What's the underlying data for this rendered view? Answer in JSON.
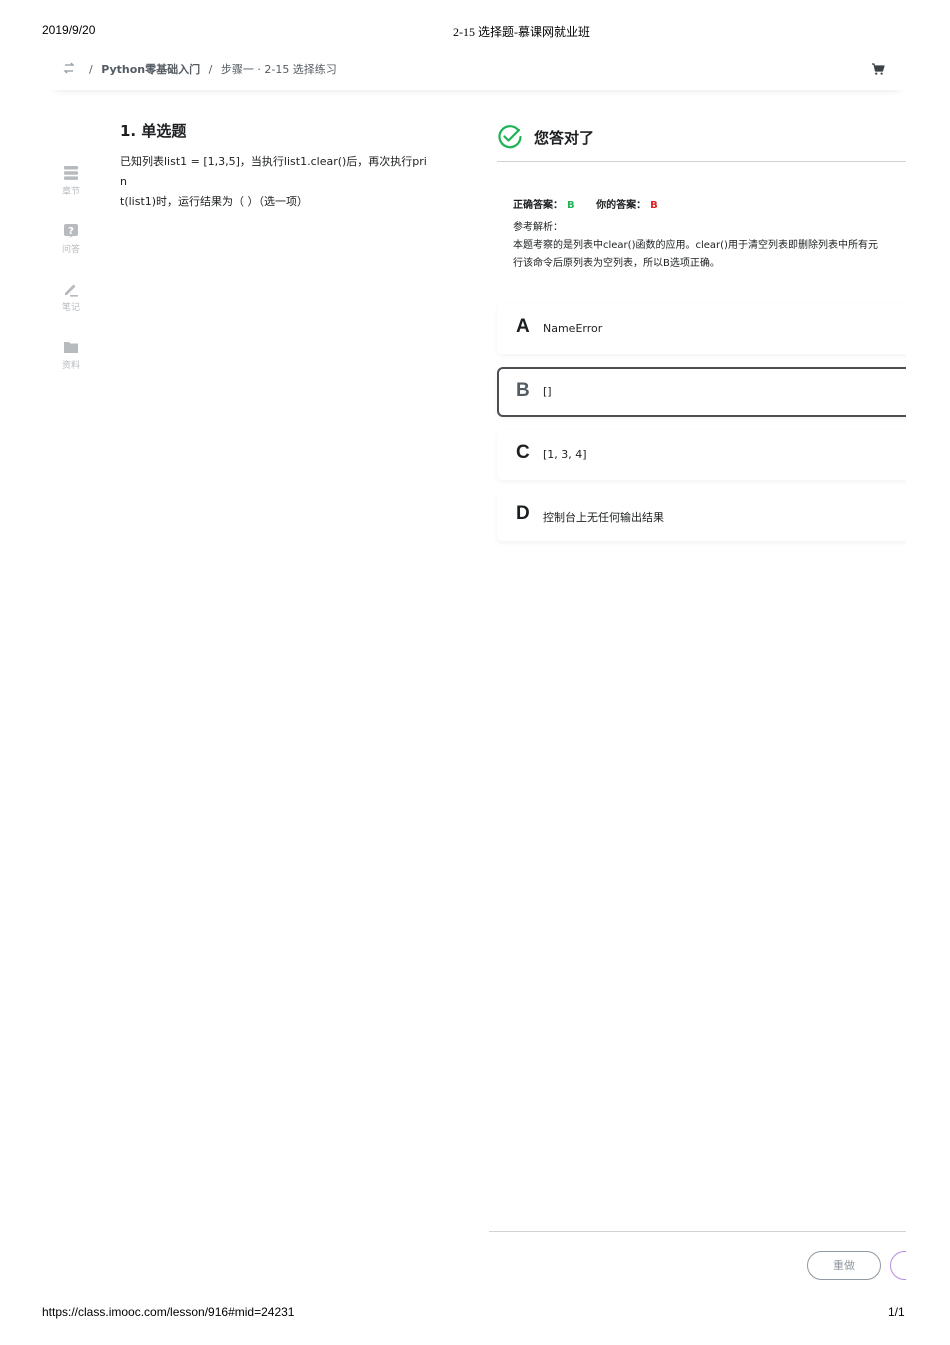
{
  "print_header": {
    "date": "2019/9/20",
    "title": "2-15 选择题-慕课网就业班"
  },
  "print_footer": {
    "url": "https://class.imooc.com/lesson/916#mid=24231",
    "page": "1/1"
  },
  "topbar": {
    "sep1": "/",
    "course": "Python零基础入门",
    "sep2": "/",
    "step": "步骤一 · 2-15 选择练习",
    "cart_icon": "cart-icon"
  },
  "sidenav": {
    "items": [
      {
        "icon": "chapters-icon",
        "label": "章节"
      },
      {
        "icon": "qa-icon",
        "label": "问答"
      },
      {
        "icon": "pencil-icon",
        "label": "笔记"
      },
      {
        "icon": "folder-icon",
        "label": "资料"
      }
    ]
  },
  "question": {
    "title": "1. 单选题",
    "text_line1": "已知列表list1 = [1,3,5]，当执行list1.clear()后，再次执行prin",
    "text_line2": "t(list1)时，运行结果为（ ）（选一项）"
  },
  "result": {
    "text": "您答对了",
    "color": "#1fb356"
  },
  "answers": {
    "correct_label": "正确答案：",
    "correct_value": "B",
    "yours_label": "你的答案：",
    "yours_value": "B"
  },
  "analysis": {
    "label": "参考解析：",
    "line1": "本题考察的是列表中clear()函数的应用。clear()用于清空列表即删除列表中所有元",
    "line2": "行该命令后原列表为空列表，所以B选项正确。"
  },
  "options": [
    {
      "letter": "A",
      "text": "NameError",
      "selected": false
    },
    {
      "letter": "B",
      "text": "[]",
      "selected": true
    },
    {
      "letter": "C",
      "text": "[1, 3, 4]",
      "selected": false
    },
    {
      "letter": "D",
      "text": "控制台上无任何输出结果",
      "selected": false
    }
  ],
  "buttons": {
    "redo": "重做"
  }
}
